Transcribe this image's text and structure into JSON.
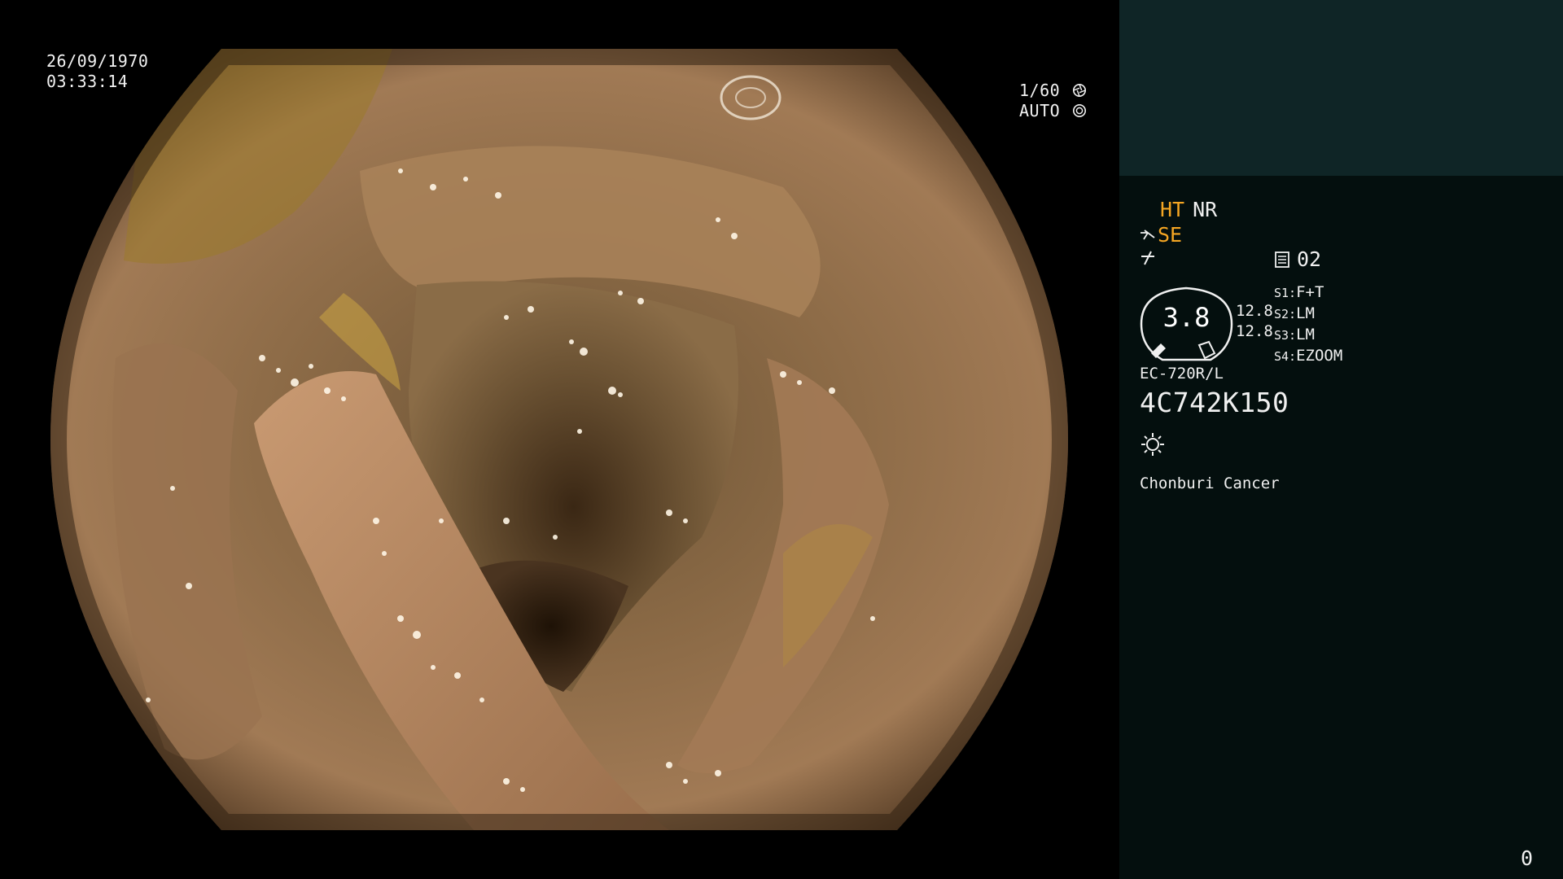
{
  "overlay": {
    "date": "26/09/1970",
    "time": "03:33:14",
    "shutter": "1/60",
    "shutter_icon": "aperture-icon",
    "iris": "AUTO",
    "iris_icon": "iris-icon"
  },
  "panel": {
    "enhancement": "HT",
    "noise_reduction": "NR",
    "structure": "SE",
    "memo_number": "02",
    "gauge_value": "3.8",
    "lamp_values": [
      "12.8",
      "12.8"
    ],
    "scope_switches": [
      {
        "key": "S1:",
        "value": "F+T"
      },
      {
        "key": "S2:",
        "value": "LM"
      },
      {
        "key": "S3:",
        "value": "LM"
      },
      {
        "key": "S4:",
        "value": "EZOOM"
      }
    ],
    "scope_model": "EC-720R/L",
    "scope_serial": "4C742K150",
    "hospital": "Chonburi Cancer",
    "counter": "0"
  },
  "colors": {
    "accent": "#f5a623",
    "panel_top": "#0f2526",
    "panel_body": "#040f0e"
  }
}
